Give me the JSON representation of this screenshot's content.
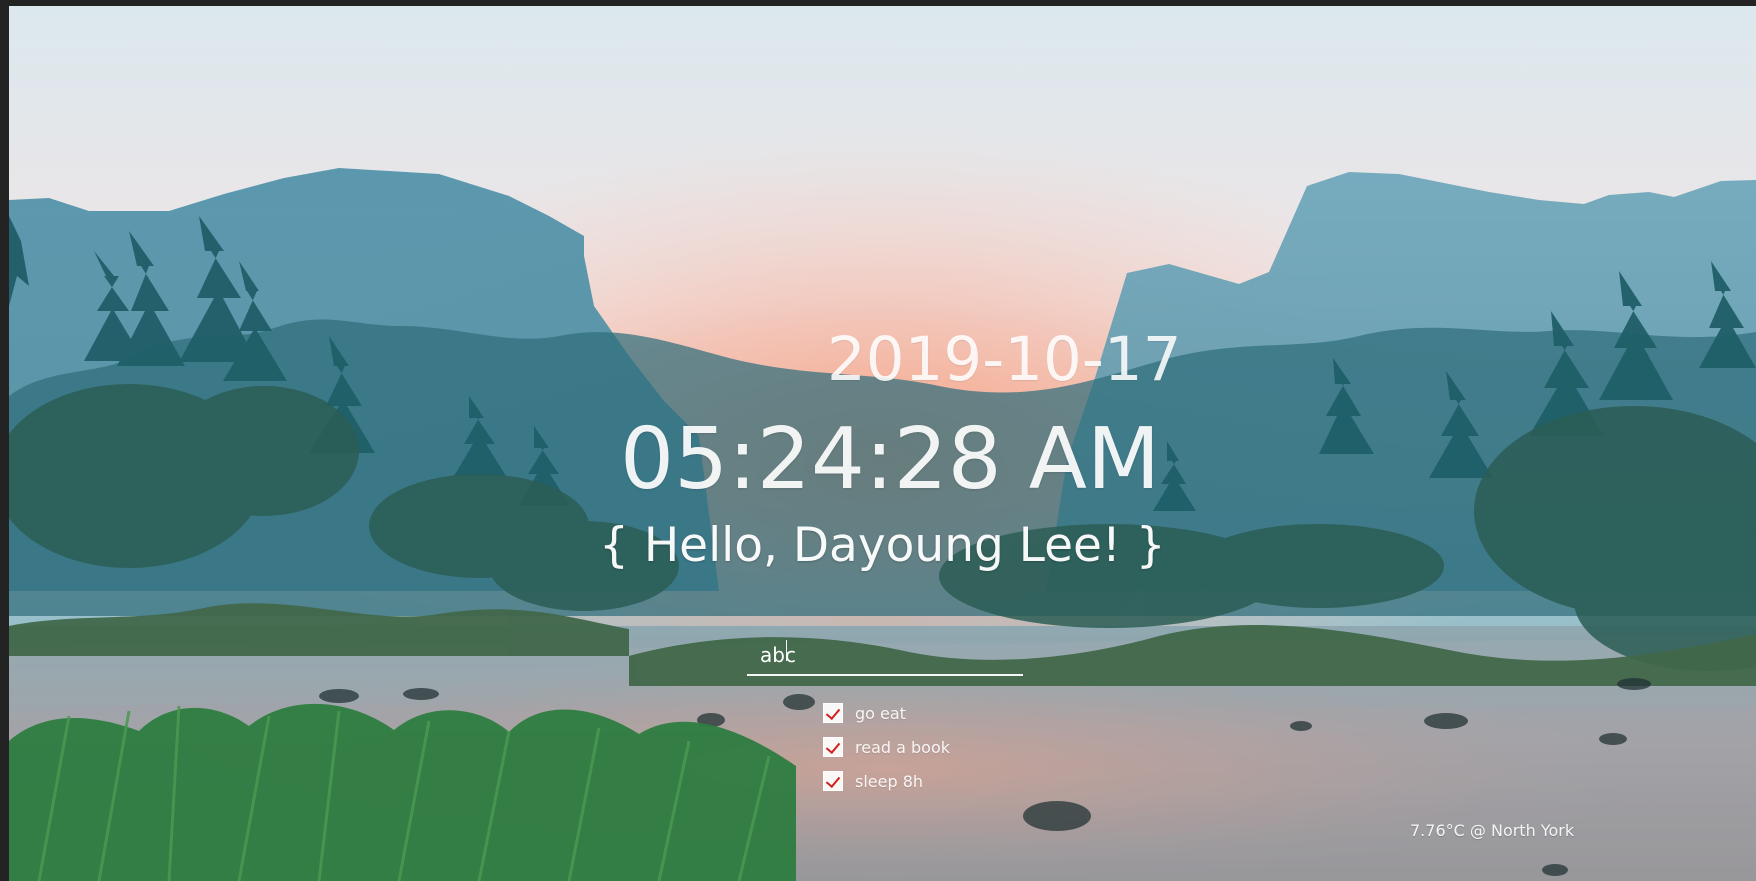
{
  "clock": {
    "date": "2019-10-17",
    "time": "05:24:28 AM",
    "greeting": "{ Hello, Dayoung Lee! }"
  },
  "todo": {
    "input_value": "abc",
    "items": [
      {
        "label": "go eat",
        "checked": true
      },
      {
        "label": "read a book",
        "checked": true
      },
      {
        "label": "sleep 8h",
        "checked": true
      }
    ]
  },
  "weather": {
    "text": "7.76°C @ North York"
  },
  "icons": {
    "checkbox_checked": "checkbox-checked-icon"
  },
  "colors": {
    "text": "#ffffff",
    "check_mark": "#d02020"
  }
}
